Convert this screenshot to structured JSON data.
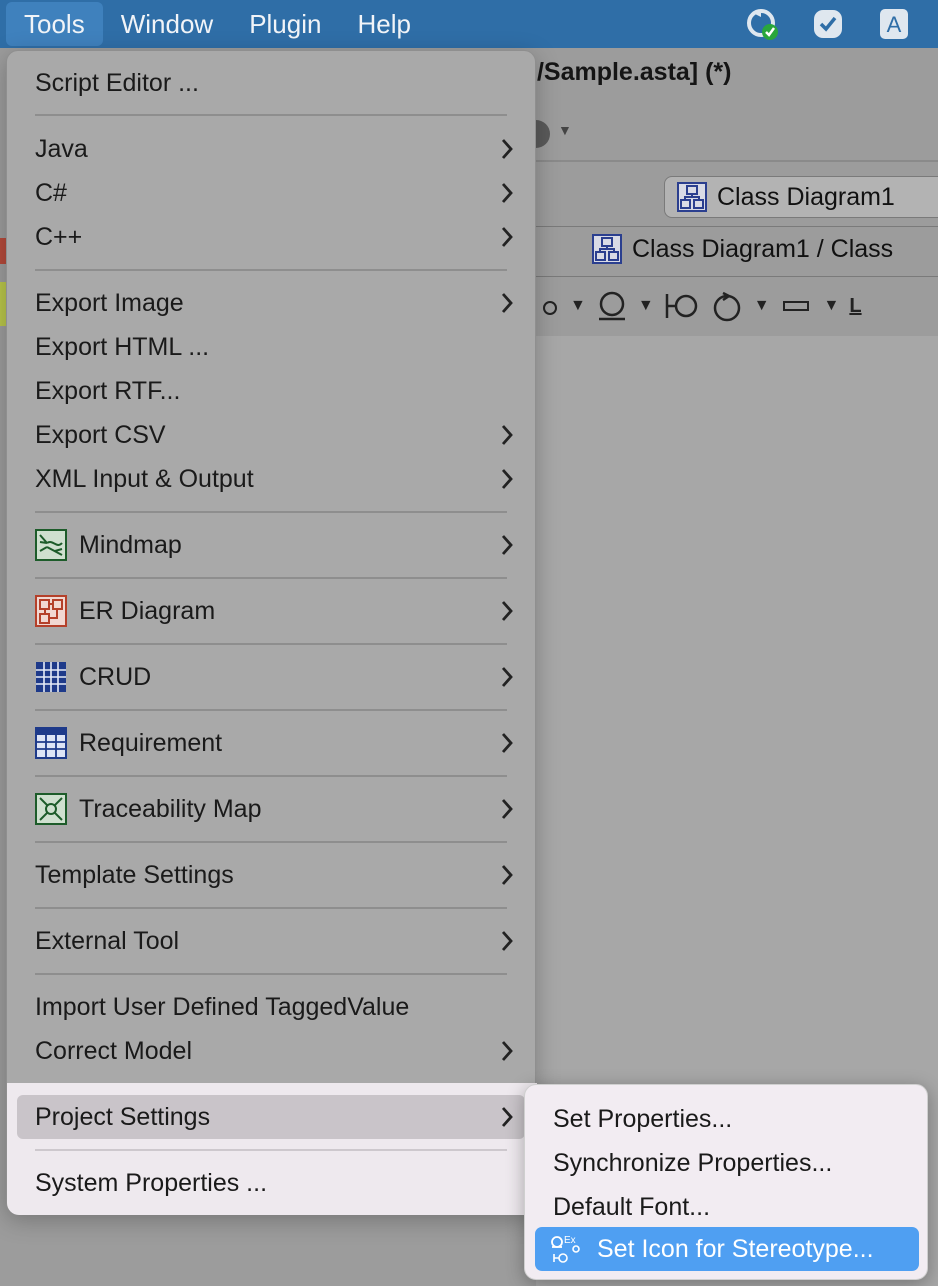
{
  "menubar": {
    "items": [
      "Tools",
      "Window",
      "Plugin",
      "Help"
    ],
    "status_icons": [
      "sync-check-icon",
      "shield-check-icon",
      "input-source-icon"
    ],
    "input_source_label": "A"
  },
  "background": {
    "window_title": "l/Sample.asta] (*)",
    "diagram_tab": "Class Diagram1",
    "breadcrumb": "Class Diagram1 / Class",
    "shape_tool_label": "L"
  },
  "tools_menu": {
    "items": [
      {
        "label": "Script Editor ...",
        "submenu": false
      },
      {
        "label": "Java",
        "submenu": true
      },
      {
        "label": "C#",
        "submenu": true
      },
      {
        "label": "C++",
        "submenu": true
      },
      {
        "label": "Export Image",
        "submenu": true
      },
      {
        "label": "Export HTML ...",
        "submenu": false
      },
      {
        "label": "Export RTF...",
        "submenu": false
      },
      {
        "label": "Export CSV",
        "submenu": true
      },
      {
        "label": "XML Input & Output",
        "submenu": true
      },
      {
        "label": "Mindmap",
        "submenu": true,
        "icon": "mindmap-icon"
      },
      {
        "label": "ER Diagram",
        "submenu": true,
        "icon": "er-diagram-icon"
      },
      {
        "label": "CRUD",
        "submenu": true,
        "icon": "crud-icon"
      },
      {
        "label": "Requirement",
        "submenu": true,
        "icon": "requirement-table-icon"
      },
      {
        "label": "Traceability Map",
        "submenu": true,
        "icon": "traceability-map-icon"
      },
      {
        "label": "Template Settings",
        "submenu": true
      },
      {
        "label": "External Tool",
        "submenu": true
      },
      {
        "label": "Import User Defined TaggedValue",
        "submenu": false
      },
      {
        "label": "Correct Model",
        "submenu": true
      },
      {
        "label": "Project Settings",
        "submenu": true,
        "highlighted": true
      },
      {
        "label": "System Properties ...",
        "submenu": false
      }
    ]
  },
  "project_settings_submenu": {
    "items": [
      {
        "label": "Set Properties..."
      },
      {
        "label": "Synchronize Properties..."
      },
      {
        "label": "Default Font..."
      },
      {
        "label": "Set Icon for Stereotype...",
        "selected": true,
        "icon": "stereotype-icon",
        "icon_text": "Ex"
      }
    ]
  },
  "colors": {
    "menubar": "#2f6ea7",
    "selection": "#4f9ff2",
    "submenu_bg": "#f2ecf2"
  }
}
